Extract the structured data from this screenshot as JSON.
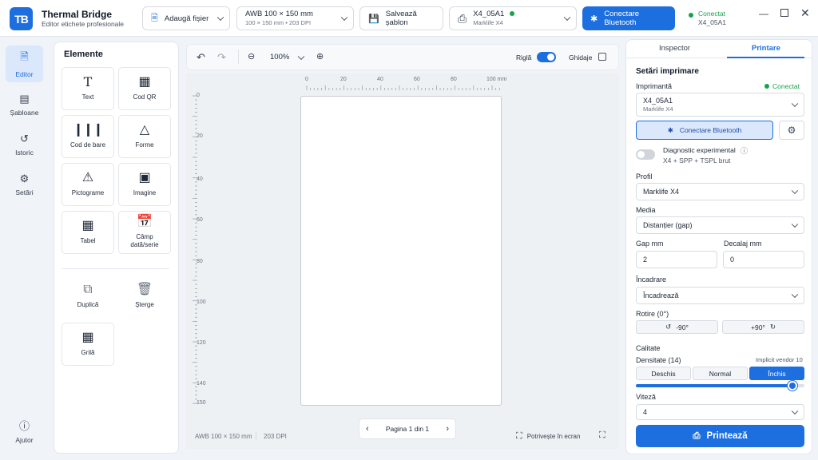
{
  "app": {
    "logo": "TB",
    "title": "Thermal Bridge",
    "subtitle": "Editor etichete profesionale"
  },
  "topbar": {
    "add_file": "Adaugă fișier",
    "media_title": "AWB 100 × 150 mm",
    "media_sub": "100 × 150 mm • 203 DPI",
    "save_template": "Salvează șablon",
    "printer_name": "X4_05A1",
    "printer_model": "Marklife X4",
    "connect_bt": "Conectare Bluetooth",
    "status": "Conectat",
    "status_device": "X4_05A1",
    "status_color": "#16a34a",
    "accent": "#1d6fe0"
  },
  "sidebar": {
    "items": [
      {
        "label": "Editor",
        "icon": "file-icon"
      },
      {
        "label": "Șabloane",
        "icon": "template-icon"
      },
      {
        "label": "Istoric",
        "icon": "history-icon"
      },
      {
        "label": "Setări",
        "icon": "gear-icon"
      }
    ],
    "help": "Ajutor"
  },
  "elements": {
    "title": "Elemente",
    "tiles": [
      "Text",
      "Cod QR",
      "Cod de bare",
      "Forme",
      "Pictograme",
      "Imagine",
      "Tabel",
      "Câmp dată/serie"
    ],
    "actions": [
      "Duplică",
      "Șterge",
      "Grilă"
    ]
  },
  "toolbar": {
    "zoom": "100%",
    "ruler": "Riglă",
    "ruler_on": true,
    "guides": "Ghidaje",
    "guides_on": false
  },
  "ruler": {
    "h_ticks": [
      "0",
      "20",
      "40",
      "60",
      "80",
      "100 mm"
    ],
    "v_ticks": [
      "0",
      "20",
      "40",
      "60",
      "80",
      "100",
      "120",
      "140",
      "150"
    ]
  },
  "footer": {
    "media": "AWB 100 × 150 mm",
    "dpi": "203 DPI",
    "page": "Pagina 1 din 1",
    "fit": "Potrivește în ecran"
  },
  "inspector": {
    "tabs": [
      "Inspector",
      "Printare"
    ],
    "active_tab": "Printare",
    "section": "Setări imprimare",
    "printer_label": "Imprimantă",
    "printer_status": "Conectat",
    "printer_name": "X4_05A1",
    "printer_model": "Marklife X4",
    "connect_bt": "Conectare Bluetooth",
    "diag_label": "Diagnostic experimental",
    "diag_sub": "X4 + SPP + TSPL brut",
    "diag_on": false,
    "profile_label": "Profil",
    "profile_value": "Marklife X4",
    "media_label": "Media",
    "media_value": "Distanțier (gap)",
    "gap_label": "Gap mm",
    "gap_value": "2",
    "offset_label": "Decalaj mm",
    "offset_value": "0",
    "fit_label": "Încadrare",
    "fit_value": "Încadrează",
    "rotate_label": "Rotire (0°)",
    "rotate_left": "-90°",
    "rotate_right": "+90°",
    "quality_label": "Calitate",
    "density_label": "Densitate (14)",
    "density_hint": "Implicit vendor 10",
    "density_options": [
      "Deschis",
      "Normal",
      "Închis"
    ],
    "density_selected": "Închis",
    "density_level": 0.93,
    "speed_label": "Viteză",
    "speed_value": "4",
    "print_button": "Printează"
  }
}
